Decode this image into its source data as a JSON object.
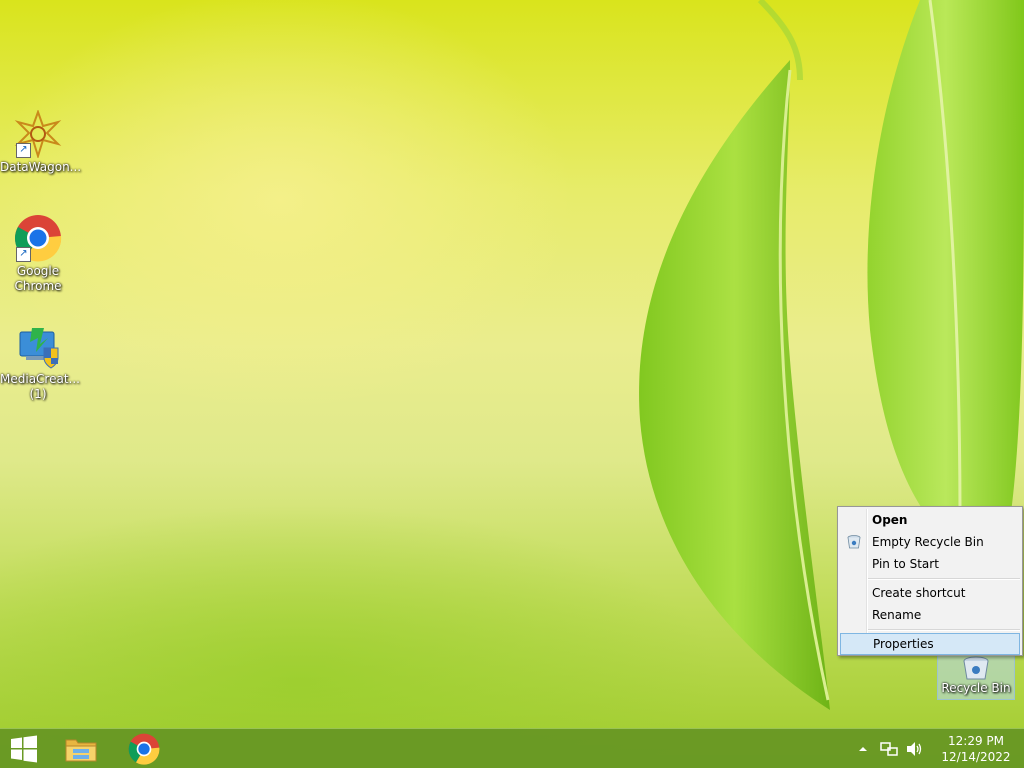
{
  "desktop": {
    "icons": [
      {
        "label": "DataWagon...",
        "icon": "datawagon-icon"
      },
      {
        "label": "Google Chrome",
        "icon": "chrome-icon"
      },
      {
        "label": "MediaCreat... (1)",
        "icon": "media-creation-tool-icon"
      }
    ],
    "recycle_bin": {
      "label": "Recycle Bin",
      "icon": "recycle-bin-icon"
    }
  },
  "context_menu": {
    "items": [
      {
        "label": "Open",
        "bold": true
      },
      {
        "label": "Empty Recycle Bin",
        "icon": "recycle-bin-small-icon"
      },
      {
        "label": "Pin to Start"
      },
      {
        "label": "Create shortcut"
      },
      {
        "label": "Rename"
      },
      {
        "label": "Properties",
        "highlighted": true
      }
    ]
  },
  "taskbar": {
    "start": {
      "icon": "windows-logo-icon"
    },
    "pinned": [
      {
        "icon": "file-explorer-icon"
      },
      {
        "icon": "chrome-icon"
      }
    ],
    "tray": {
      "icons": [
        "show-hidden-icons-chevron",
        "network-icon",
        "volume-icon"
      ],
      "time": "12:29 PM",
      "date": "12/14/2022"
    }
  },
  "colors": {
    "taskbar": "#669624",
    "menu_highlight": "#d5e8f7"
  }
}
